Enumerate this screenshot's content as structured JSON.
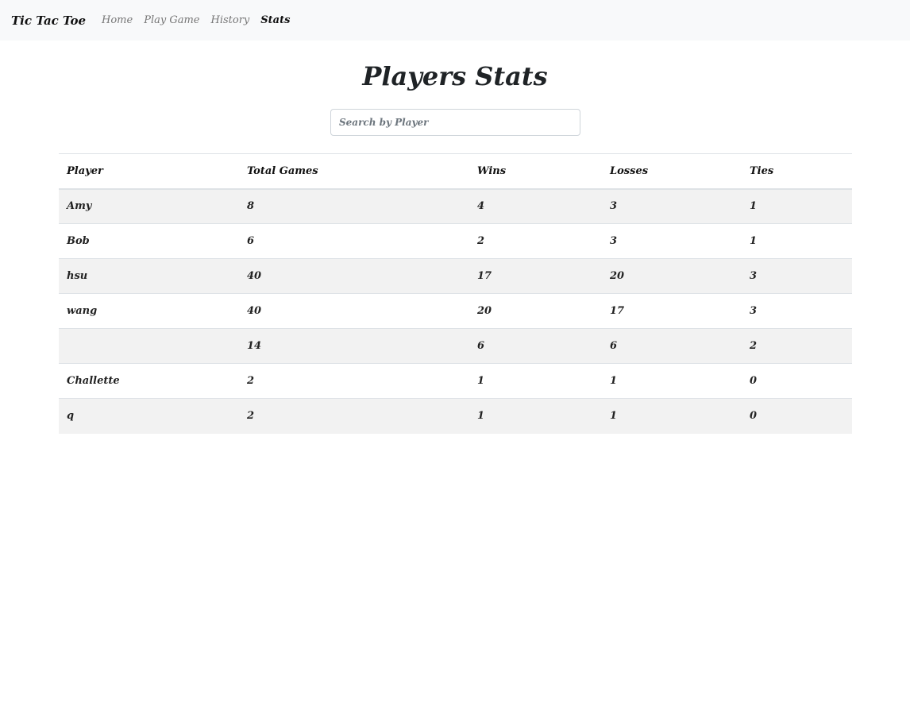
{
  "navbar": {
    "brand": "Tic Tac Toe",
    "links": [
      {
        "label": "Home",
        "active": false
      },
      {
        "label": "Play Game",
        "active": false
      },
      {
        "label": "History",
        "active": false
      },
      {
        "label": "Stats",
        "active": true
      }
    ]
  },
  "page": {
    "title": "Players Stats"
  },
  "search": {
    "placeholder": "Search by Player",
    "value": ""
  },
  "table": {
    "columns": [
      "Player",
      "Total Games",
      "Wins",
      "Losses",
      "Ties"
    ],
    "rows": [
      {
        "player": "Amy",
        "total": "8",
        "wins": "4",
        "losses": "3",
        "ties": "1"
      },
      {
        "player": "Bob",
        "total": "6",
        "wins": "2",
        "losses": "3",
        "ties": "1"
      },
      {
        "player": "hsu",
        "total": "40",
        "wins": "17",
        "losses": "20",
        "ties": "3"
      },
      {
        "player": "wang",
        "total": "40",
        "wins": "20",
        "losses": "17",
        "ties": "3"
      },
      {
        "player": "",
        "total": "14",
        "wins": "6",
        "losses": "6",
        "ties": "2"
      },
      {
        "player": "Challette",
        "total": "2",
        "wins": "1",
        "losses": "1",
        "ties": "0"
      },
      {
        "player": "q",
        "total": "2",
        "wins": "1",
        "losses": "1",
        "ties": "0"
      }
    ]
  },
  "colors": {
    "navbar_bg": "#f8f9fa",
    "stripe_bg": "#f2f2f2",
    "text": "#212529",
    "muted_link": "#777777"
  }
}
